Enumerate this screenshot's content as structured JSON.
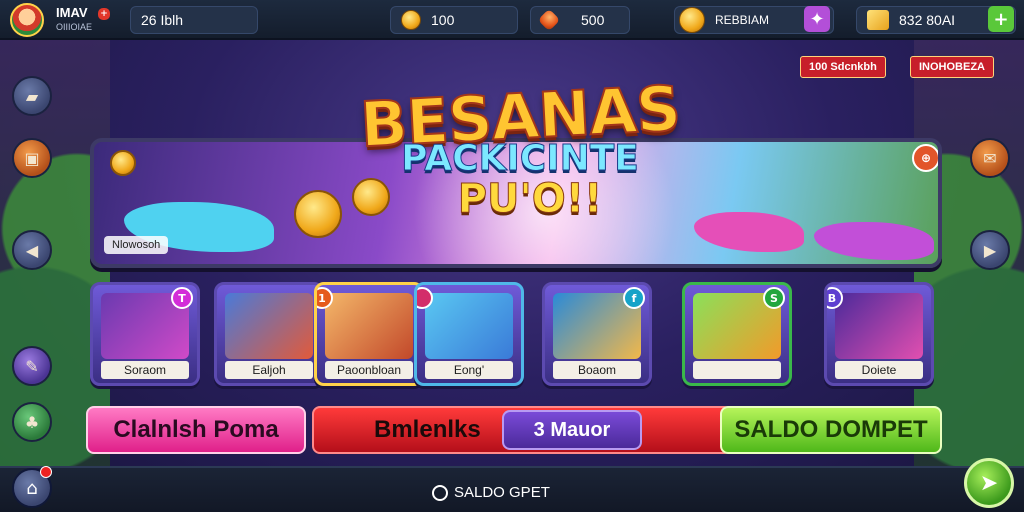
{
  "player": {
    "name": "IMAV",
    "sub": "OIIIOIAE"
  },
  "topbar": {
    "level_text": "26 Iblh",
    "coins": "100",
    "gems": "500",
    "offer_label": "REBBIAM",
    "chests": "832 80AI"
  },
  "banner": {
    "title": "BESANAS",
    "subtitle": "PACKICINTE",
    "subtitle2": "PU'O!!",
    "caption": "Nlowosoh",
    "tag_left": "100 Sdcnkbh",
    "tag_right": "INOHOBEZA"
  },
  "tiles": [
    {
      "name": "Soraom",
      "badge": "T",
      "badge_color": "#d32dd8"
    },
    {
      "name": "Ealjoh",
      "badge": "",
      "badge_color": ""
    },
    {
      "name": "Paoonbloan",
      "badge": "1",
      "badge_color": "#e55b1c"
    },
    {
      "name": "Eong'",
      "badge": "",
      "badge_color": "#d32d6a"
    },
    {
      "name": "Boaom",
      "badge": "f",
      "badge_color": "#16a3c8"
    },
    {
      "name": "",
      "badge": "S",
      "badge_color": "#22a63e"
    },
    {
      "name": "Doiete",
      "badge": "B",
      "badge_color": "#5e3fd0"
    }
  ],
  "actions": {
    "left": "Clalnlsh Poma",
    "middle": "Bmlenlks",
    "middle_pill": "3 Mauor",
    "right": "SALDO DOMPET"
  },
  "bottom": {
    "label": "SALDO GPET"
  },
  "colors": {
    "accent_green": "#7ee23a",
    "accent_pink": "#ff4fa8",
    "accent_red": "#d41d2a",
    "accent_purple": "#5d2fb0"
  }
}
